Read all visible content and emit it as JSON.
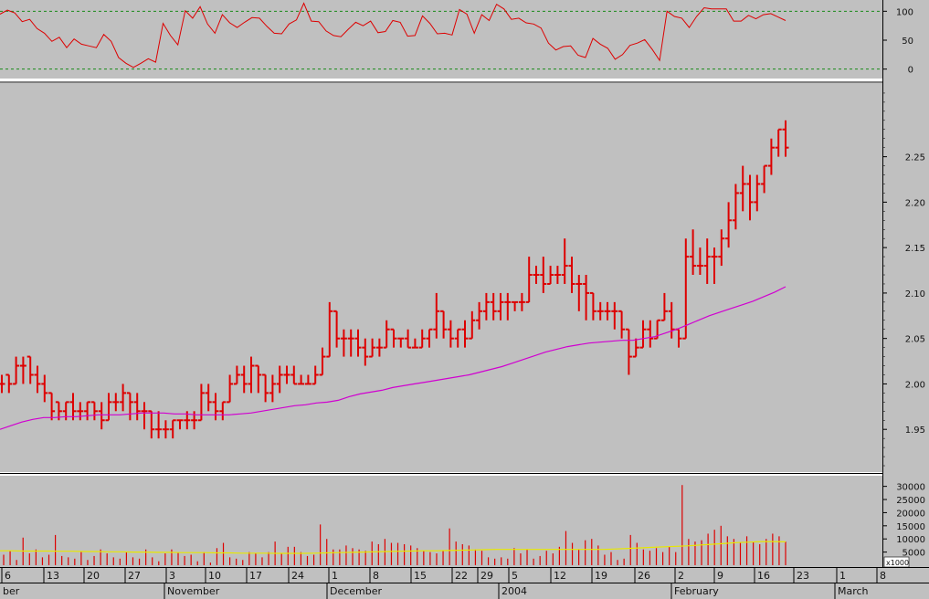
{
  "chart_data": [
    {
      "panel": "oscillator",
      "type": "line",
      "ylim": [
        -10,
        110
      ],
      "y_ticks": [
        0,
        50,
        100
      ],
      "reference_lines": [
        0,
        100
      ],
      "colors": {
        "line": "#dd0000",
        "reference": "#1a8a1a"
      },
      "values": [
        95,
        102,
        97,
        82,
        86,
        70,
        62,
        48,
        55,
        37,
        52,
        43,
        40,
        37,
        60,
        48,
        20,
        10,
        3,
        10,
        18,
        12,
        79,
        58,
        42,
        101,
        88,
        108,
        78,
        62,
        94,
        80,
        72,
        81,
        89,
        88,
        74,
        62,
        61,
        78,
        85,
        114,
        83,
        82,
        66,
        58,
        56,
        69,
        81,
        75,
        83,
        63,
        65,
        84,
        81,
        57,
        58,
        92,
        79,
        61,
        62,
        59,
        103,
        95,
        62,
        94,
        84,
        112,
        104,
        86,
        88,
        80,
        78,
        71,
        45,
        33,
        39,
        40,
        24,
        20,
        53,
        43,
        36,
        17,
        25,
        41,
        45,
        51,
        34,
        15,
        100,
        91,
        88,
        72,
        91,
        106,
        104,
        104,
        104,
        83,
        83,
        93,
        87,
        94,
        96,
        90,
        84
      ]
    },
    {
      "panel": "price",
      "type": "ohlc",
      "ylim": [
        1.905,
        2.33
      ],
      "y_ticks": [
        "1.95",
        "2.00",
        "2.05",
        "2.10",
        "2.15",
        "2.20",
        "2.25"
      ],
      "colors": {
        "bars": "#dd0000",
        "moving_average": "#d000d0"
      },
      "ohlc": [
        [
          2.0,
          2.01,
          1.99,
          2.0
        ],
        [
          2.01,
          2.01,
          1.99,
          2.0
        ],
        [
          2.0,
          2.03,
          2.0,
          2.02
        ],
        [
          2.02,
          2.03,
          2.0,
          2.02
        ],
        [
          2.03,
          2.03,
          2.0,
          2.01
        ],
        [
          2.01,
          2.02,
          1.99,
          2.0
        ],
        [
          2.0,
          2.01,
          1.98,
          1.99
        ],
        [
          1.99,
          1.99,
          1.96,
          1.97
        ],
        [
          1.98,
          1.98,
          1.96,
          1.97
        ],
        [
          1.97,
          1.98,
          1.96,
          1.98
        ],
        [
          1.98,
          1.99,
          1.96,
          1.97
        ],
        [
          1.97,
          1.98,
          1.96,
          1.97
        ],
        [
          1.97,
          1.98,
          1.96,
          1.98
        ],
        [
          1.98,
          1.98,
          1.96,
          1.97
        ],
        [
          1.97,
          1.98,
          1.95,
          1.96
        ],
        [
          1.96,
          1.99,
          1.96,
          1.98
        ],
        [
          1.98,
          1.99,
          1.97,
          1.98
        ],
        [
          1.98,
          2.0,
          1.97,
          1.99
        ],
        [
          1.99,
          1.99,
          1.96,
          1.98
        ],
        [
          1.98,
          1.99,
          1.96,
          1.97
        ],
        [
          1.97,
          1.98,
          1.95,
          1.97
        ],
        [
          1.97,
          1.97,
          1.94,
          1.95
        ],
        [
          1.95,
          1.97,
          1.94,
          1.95
        ],
        [
          1.95,
          1.96,
          1.94,
          1.95
        ],
        [
          1.95,
          1.96,
          1.94,
          1.96
        ],
        [
          1.96,
          1.96,
          1.95,
          1.96
        ],
        [
          1.96,
          1.97,
          1.95,
          1.96
        ],
        [
          1.96,
          1.97,
          1.95,
          1.96
        ],
        [
          1.96,
          2.0,
          1.96,
          1.99
        ],
        [
          1.99,
          2.0,
          1.97,
          1.98
        ],
        [
          1.98,
          1.99,
          1.96,
          1.97
        ],
        [
          1.97,
          1.98,
          1.96,
          1.98
        ],
        [
          1.98,
          2.01,
          1.98,
          2.0
        ],
        [
          2.0,
          2.02,
          2.0,
          2.01
        ],
        [
          2.01,
          2.02,
          1.99,
          2.0
        ],
        [
          2.0,
          2.03,
          1.99,
          2.02
        ],
        [
          2.02,
          2.02,
          1.99,
          2.01
        ],
        [
          2.01,
          2.01,
          1.98,
          1.99
        ],
        [
          1.99,
          2.01,
          1.98,
          2.0
        ],
        [
          2.0,
          2.02,
          1.99,
          2.01
        ],
        [
          2.01,
          2.02,
          2.0,
          2.01
        ],
        [
          2.01,
          2.02,
          2.0,
          2.0
        ],
        [
          2.0,
          2.01,
          2.0,
          2.0
        ],
        [
          2.0,
          2.01,
          2.0,
          2.0
        ],
        [
          2.0,
          2.02,
          2.0,
          2.01
        ],
        [
          2.01,
          2.04,
          2.01,
          2.03
        ],
        [
          2.03,
          2.09,
          2.03,
          2.08
        ],
        [
          2.08,
          2.08,
          2.04,
          2.05
        ],
        [
          2.05,
          2.06,
          2.03,
          2.05
        ],
        [
          2.05,
          2.06,
          2.03,
          2.05
        ],
        [
          2.05,
          2.06,
          2.03,
          2.04
        ],
        [
          2.04,
          2.05,
          2.02,
          2.03
        ],
        [
          2.03,
          2.05,
          2.03,
          2.04
        ],
        [
          2.04,
          2.05,
          2.03,
          2.04
        ],
        [
          2.04,
          2.07,
          2.04,
          2.06
        ],
        [
          2.06,
          2.06,
          2.04,
          2.05
        ],
        [
          2.05,
          2.05,
          2.04,
          2.05
        ],
        [
          2.05,
          2.06,
          2.04,
          2.04
        ],
        [
          2.04,
          2.05,
          2.04,
          2.04
        ],
        [
          2.04,
          2.06,
          2.04,
          2.05
        ],
        [
          2.05,
          2.06,
          2.04,
          2.06
        ],
        [
          2.06,
          2.1,
          2.05,
          2.08
        ],
        [
          2.08,
          2.08,
          2.05,
          2.06
        ],
        [
          2.06,
          2.07,
          2.04,
          2.05
        ],
        [
          2.05,
          2.06,
          2.04,
          2.06
        ],
        [
          2.06,
          2.07,
          2.04,
          2.05
        ],
        [
          2.05,
          2.08,
          2.05,
          2.07
        ],
        [
          2.07,
          2.09,
          2.06,
          2.08
        ],
        [
          2.08,
          2.1,
          2.07,
          2.09
        ],
        [
          2.09,
          2.1,
          2.07,
          2.08
        ],
        [
          2.08,
          2.1,
          2.07,
          2.09
        ],
        [
          2.09,
          2.1,
          2.07,
          2.09
        ],
        [
          2.09,
          2.09,
          2.08,
          2.09
        ],
        [
          2.09,
          2.1,
          2.08,
          2.09
        ],
        [
          2.09,
          2.14,
          2.09,
          2.12
        ],
        [
          2.12,
          2.13,
          2.11,
          2.12
        ],
        [
          2.12,
          2.14,
          2.1,
          2.11
        ],
        [
          2.11,
          2.13,
          2.11,
          2.12
        ],
        [
          2.12,
          2.13,
          2.11,
          2.12
        ],
        [
          2.12,
          2.16,
          2.11,
          2.13
        ],
        [
          2.13,
          2.14,
          2.1,
          2.11
        ],
        [
          2.11,
          2.12,
          2.08,
          2.11
        ],
        [
          2.11,
          2.12,
          2.07,
          2.1
        ],
        [
          2.1,
          2.1,
          2.07,
          2.08
        ],
        [
          2.08,
          2.09,
          2.07,
          2.08
        ],
        [
          2.08,
          2.09,
          2.07,
          2.08
        ],
        [
          2.08,
          2.09,
          2.06,
          2.08
        ],
        [
          2.08,
          2.08,
          2.05,
          2.06
        ],
        [
          2.06,
          2.06,
          2.01,
          2.03
        ],
        [
          2.03,
          2.05,
          2.03,
          2.04
        ],
        [
          2.04,
          2.07,
          2.04,
          2.06
        ],
        [
          2.06,
          2.07,
          2.04,
          2.05
        ],
        [
          2.05,
          2.07,
          2.05,
          2.07
        ],
        [
          2.07,
          2.1,
          2.07,
          2.08
        ],
        [
          2.08,
          2.09,
          2.05,
          2.06
        ],
        [
          2.06,
          2.06,
          2.04,
          2.05
        ],
        [
          2.05,
          2.16,
          2.05,
          2.14
        ],
        [
          2.14,
          2.17,
          2.12,
          2.13
        ],
        [
          2.13,
          2.15,
          2.12,
          2.13
        ],
        [
          2.13,
          2.16,
          2.11,
          2.14
        ],
        [
          2.14,
          2.15,
          2.11,
          2.14
        ],
        [
          2.14,
          2.17,
          2.13,
          2.16
        ],
        [
          2.16,
          2.2,
          2.15,
          2.18
        ],
        [
          2.18,
          2.22,
          2.17,
          2.21
        ],
        [
          2.21,
          2.24,
          2.19,
          2.22
        ],
        [
          2.22,
          2.23,
          2.18,
          2.2
        ],
        [
          2.2,
          2.23,
          2.19,
          2.22
        ],
        [
          2.22,
          2.24,
          2.21,
          2.24
        ],
        [
          2.24,
          2.27,
          2.23,
          2.26
        ],
        [
          2.26,
          2.28,
          2.25,
          2.28
        ],
        [
          2.28,
          2.29,
          2.25,
          2.26
        ]
      ],
      "moving_average": [
        1.95,
        1.954,
        1.958,
        1.961,
        1.963,
        1.963,
        1.964,
        1.964,
        1.965,
        1.966,
        1.966,
        1.966,
        1.967,
        1.968,
        1.968,
        1.968,
        1.967,
        1.967,
        1.966,
        1.966,
        1.966,
        1.966,
        1.967,
        1.968,
        1.97,
        1.972,
        1.974,
        1.976,
        1.977,
        1.979,
        1.98,
        1.982,
        1.986,
        1.989,
        1.991,
        1.993,
        1.996,
        1.998,
        2.0,
        2.002,
        2.004,
        2.006,
        2.008,
        2.01,
        2.013,
        2.016,
        2.019,
        2.023,
        2.027,
        2.031,
        2.035,
        2.038,
        2.041,
        2.043,
        2.045,
        2.046,
        2.047,
        2.048,
        2.048,
        2.05,
        2.052,
        2.056,
        2.06,
        2.065,
        2.07,
        2.075,
        2.079,
        2.083,
        2.087,
        2.091,
        2.096,
        2.101,
        2.107
      ]
    },
    {
      "panel": "volume",
      "type": "bar",
      "ylim": [
        0,
        33000
      ],
      "y_ticks": [
        "5000",
        "10000",
        "15000",
        "20000",
        "25000",
        "30000"
      ],
      "multiplier_label": "x1000",
      "colors": {
        "bars": "#dd0000",
        "average": "#e8e800"
      },
      "volume": [
        4000,
        5500,
        2000,
        10500,
        4500,
        6000,
        3000,
        4000,
        11500,
        3500,
        3000,
        2500,
        5000,
        2000,
        3500,
        6000,
        4500,
        3000,
        2500,
        5000,
        3000,
        2500,
        6000,
        3000,
        1500,
        4500,
        6000,
        5000,
        3500,
        4000,
        1500,
        5000,
        1000,
        6500,
        8500,
        3000,
        2500,
        2000,
        5000,
        4500,
        3000,
        5000,
        9000,
        4500,
        7000,
        7000,
        5000,
        3500,
        4000,
        15500,
        10000,
        6000,
        6000,
        7500,
        6500,
        6000,
        5500,
        9000,
        8000,
        10000,
        8500,
        8500,
        8000,
        7500,
        6500,
        5500,
        5000,
        4500,
        5500,
        14000,
        9000,
        8000,
        7500,
        6000,
        5500,
        3000,
        2500,
        3000,
        2500,
        6500,
        4500,
        6000,
        2500,
        3500,
        5500,
        4500,
        7000,
        13000,
        8500,
        6000,
        9500,
        10000,
        7500,
        4000,
        5000,
        2000,
        2500,
        11500,
        8500,
        6000,
        5500,
        6500,
        5000,
        7000,
        5000,
        30500,
        10000,
        9000,
        9500,
        12000,
        13500,
        15000,
        11000,
        10000,
        8500,
        11000,
        9000,
        8000,
        10000,
        12000,
        11000,
        9000
      ],
      "volume_average": [
        5500,
        5500,
        5400,
        5400,
        5400,
        5300,
        5300,
        5200,
        5200,
        5100,
        5100,
        5000,
        5000,
        4900,
        4900,
        4800,
        4800,
        4800,
        4700,
        4700,
        4600,
        4600,
        4600,
        4500,
        4500,
        4500,
        4600,
        4700,
        4800,
        4900,
        5000,
        5100,
        5200,
        5300,
        5400,
        5500,
        5500,
        5600,
        5700,
        5800,
        5900,
        6000,
        6000,
        6000,
        6000,
        6000,
        6000,
        6000,
        6000,
        6000,
        6000,
        6200,
        6400,
        6600,
        6800,
        7000,
        7200,
        7400,
        7700,
        8000,
        8300,
        8600,
        8800,
        9000,
        9000,
        8900
      ]
    }
  ],
  "x_axis": {
    "day_labels": [
      "6",
      "13",
      "20",
      "27",
      "3",
      "10",
      "17",
      "24",
      "1",
      "8",
      "15",
      "22",
      "29",
      "5",
      "12",
      "19",
      "26",
      "2",
      "9",
      "16",
      "23",
      "1",
      "8"
    ],
    "month_labels": [
      "ber",
      "November",
      "December",
      "2004",
      "February",
      "March"
    ]
  }
}
